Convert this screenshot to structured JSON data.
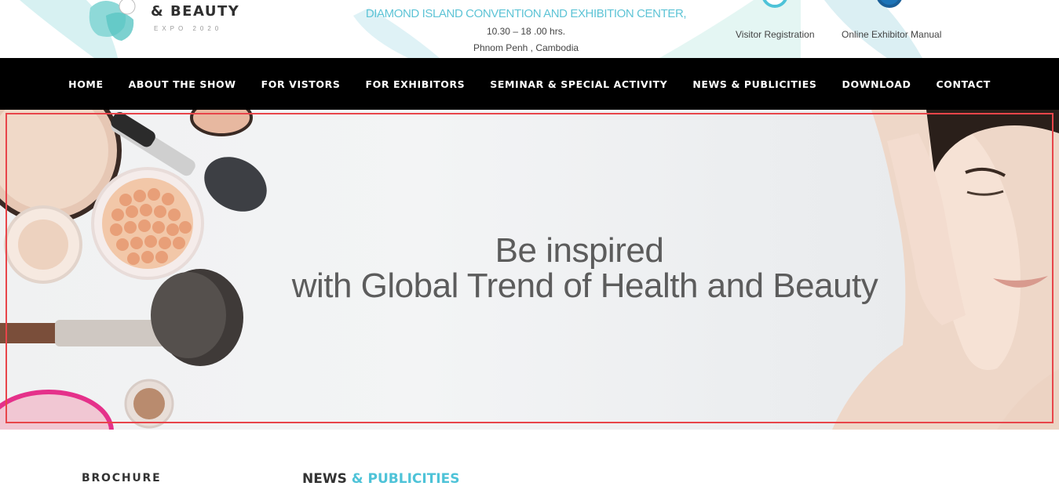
{
  "header": {
    "logo_text": "& BEAUTY",
    "logo_sub": "EXPO 2020",
    "venue": "DIAMOND ISLAND CONVENTION AND EXHIBITION CENTER,",
    "time": "10.30 – 18 .00 hrs.",
    "city": "Phnom Penh , Cambodia",
    "links": [
      {
        "label": "Visitor Registration",
        "icon": "registration-icon"
      },
      {
        "label": "Online Exhibitor Manual",
        "icon": "manual-icon"
      }
    ]
  },
  "nav": {
    "items": [
      "HOME",
      "ABOUT THE SHOW",
      "FOR VISTORS",
      "FOR EXHIBITORS",
      "SEMINAR & SPECIAL ACTIVITY",
      "NEWS & PUBLICITIES",
      "DOWNLOAD",
      "CONTACT"
    ]
  },
  "hero": {
    "line1": "Be inspired",
    "line2": "with Global Trend of Health and Beauty"
  },
  "sections": {
    "brochure": "BROCHURE",
    "news_prefix": "NEWS",
    "news_accent": "& PUBLICITIES"
  },
  "colors": {
    "accent": "#4ec3d8",
    "nav_bg": "#000000",
    "highlight_frame": "#e8454a"
  }
}
